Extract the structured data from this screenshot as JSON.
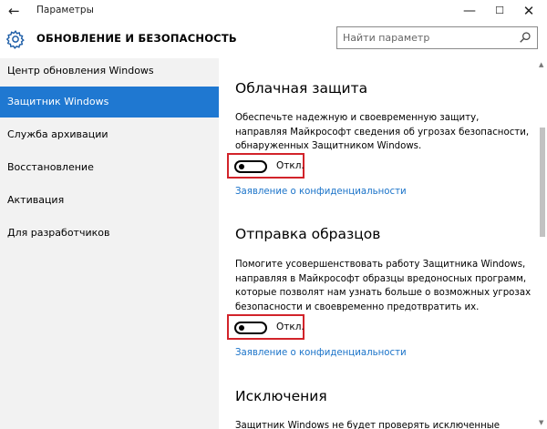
{
  "window": {
    "title": "Параметры",
    "back_glyph": "←",
    "minimize_glyph": "—",
    "maximize_glyph": "☐",
    "close_glyph": "✕"
  },
  "header": {
    "icon": "gear-icon",
    "title": "ОБНОВЛЕНИЕ И БЕЗОПАСНОСТЬ",
    "search_placeholder": "Найти параметр",
    "search_icon": "search-icon"
  },
  "sidebar": {
    "items": [
      {
        "label": "Центр обновления Windows",
        "active": false
      },
      {
        "label": "Защитник Windows",
        "active": true
      },
      {
        "label": "Служба архивации",
        "active": false
      },
      {
        "label": "Восстановление",
        "active": false
      },
      {
        "label": "Активация",
        "active": false
      },
      {
        "label": "Для разработчиков",
        "active": false
      }
    ]
  },
  "main": {
    "cloud": {
      "heading": "Облачная защита",
      "description": "Обеспечьте надежную и своевременную защиту, направляя Майкрософт сведения об угрозах безопасности, обнаруженных Защитником Windows.",
      "toggle_label": "Откл.",
      "toggle_on": false,
      "link": "Заявление о конфиденциальности"
    },
    "samples": {
      "heading": "Отправка образцов",
      "description": "Помогите усовершенствовать работу Защитника Windows, направляя в Майкрософт образцы вредоносных программ, которые позволят нам узнать больше о возможных угрозах безопасности и своевременно предотвратить их.",
      "toggle_label": "Откл.",
      "toggle_on": false,
      "link": "Заявление о конфиденциальности"
    },
    "exclusions": {
      "heading": "Исключения",
      "description": "Защитник Windows не будет проверять исключенные файлы."
    }
  },
  "colors": {
    "accent": "#1f78d1",
    "link": "#1a73c9",
    "highlight_box": "#d2232a",
    "sidebar_bg": "#f2f2f2"
  }
}
